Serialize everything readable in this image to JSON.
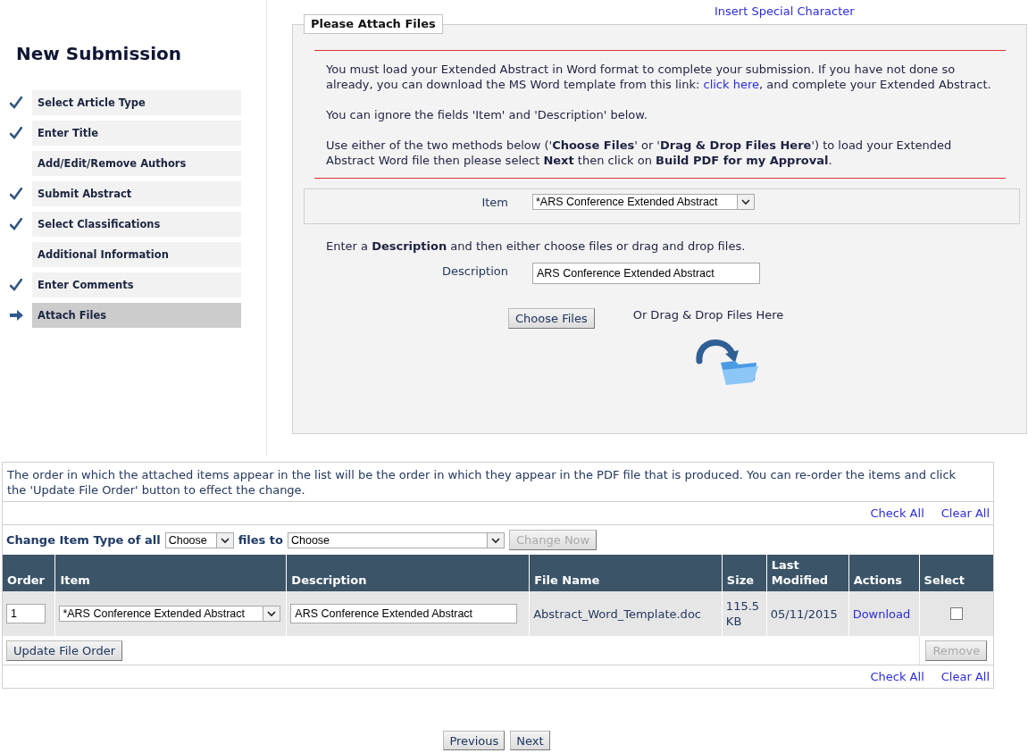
{
  "top_link": "Insert Special Character",
  "sidebar": {
    "title": "New Submission",
    "steps": [
      {
        "label": "Select Article Type",
        "completed": true,
        "selected": false
      },
      {
        "label": "Enter Title",
        "completed": true,
        "selected": false
      },
      {
        "label": "Add/Edit/Remove Authors",
        "completed": false,
        "selected": false
      },
      {
        "label": "Submit Abstract",
        "completed": true,
        "selected": false
      },
      {
        "label": "Select Classifications",
        "completed": true,
        "selected": false
      },
      {
        "label": "Additional Information",
        "completed": false,
        "selected": false
      },
      {
        "label": "Enter Comments",
        "completed": true,
        "selected": false
      },
      {
        "label": "Attach Files",
        "completed": false,
        "selected": true
      }
    ]
  },
  "attach_panel": {
    "title": "Please Attach Files",
    "intro": {
      "before": "You must load your Extended Abstract in Word format to complete your submission. If you have not done so already, you can download the MS Word template from this link: ",
      "link": "click here",
      "after": ", and complete your Extended Abstract."
    },
    "ignore_note": "You can ignore the fields 'Item' and 'Description' below.",
    "methods_note": "Use either of the two methods below ('**Choose Files**' or '**Drag & Drop Files Here**') to load your Extended Abstract Word file then please select **Next** then click on **Build PDF for my Approval**.",
    "item_field": {
      "label": "Item",
      "value": "*ARS Conference Extended Abstract"
    },
    "description_hint": "Enter a **Description** and then either choose files or drag and drop files.",
    "description_field": {
      "label": "Description",
      "value": "ARS Conference Extended Abstract"
    },
    "choose_button": "Choose Files",
    "drop_label": "Or Drag & Drop Files Here"
  },
  "files": {
    "note": "The order in which the attached items appear in the list will be the order in which they appear in the PDF file that is produced. You can re-order the items and click the 'Update File Order' button to effect the change.",
    "top_links": [
      "Check All",
      "Clear All"
    ],
    "change_type": {
      "label": "Change Item Type of all",
      "first_select": "Choose",
      "middle": "files to",
      "second_select": "Choose",
      "button": {
        "label": "Change Now",
        "disabled": true
      }
    },
    "columns": [
      "Order",
      "Item",
      "Description",
      "File Name",
      "Size",
      "Last Modified",
      "Actions",
      "Select"
    ],
    "rows": [
      {
        "order": "1",
        "item": "*ARS Conference Extended Abstract",
        "description": "ARS Conference Extended Abstract",
        "file_name": "Abstract_Word_Template.doc",
        "size": "115.5 KB",
        "last_modified": "05/11/2015",
        "action": "Download",
        "selected": false
      }
    ],
    "update_button": "Update File Order",
    "remove_button": {
      "label": "Remove",
      "disabled": true
    },
    "bottom_links": [
      "Check All",
      "Clear All"
    ]
  },
  "nav_buttons": [
    "Previous",
    "Next"
  ]
}
